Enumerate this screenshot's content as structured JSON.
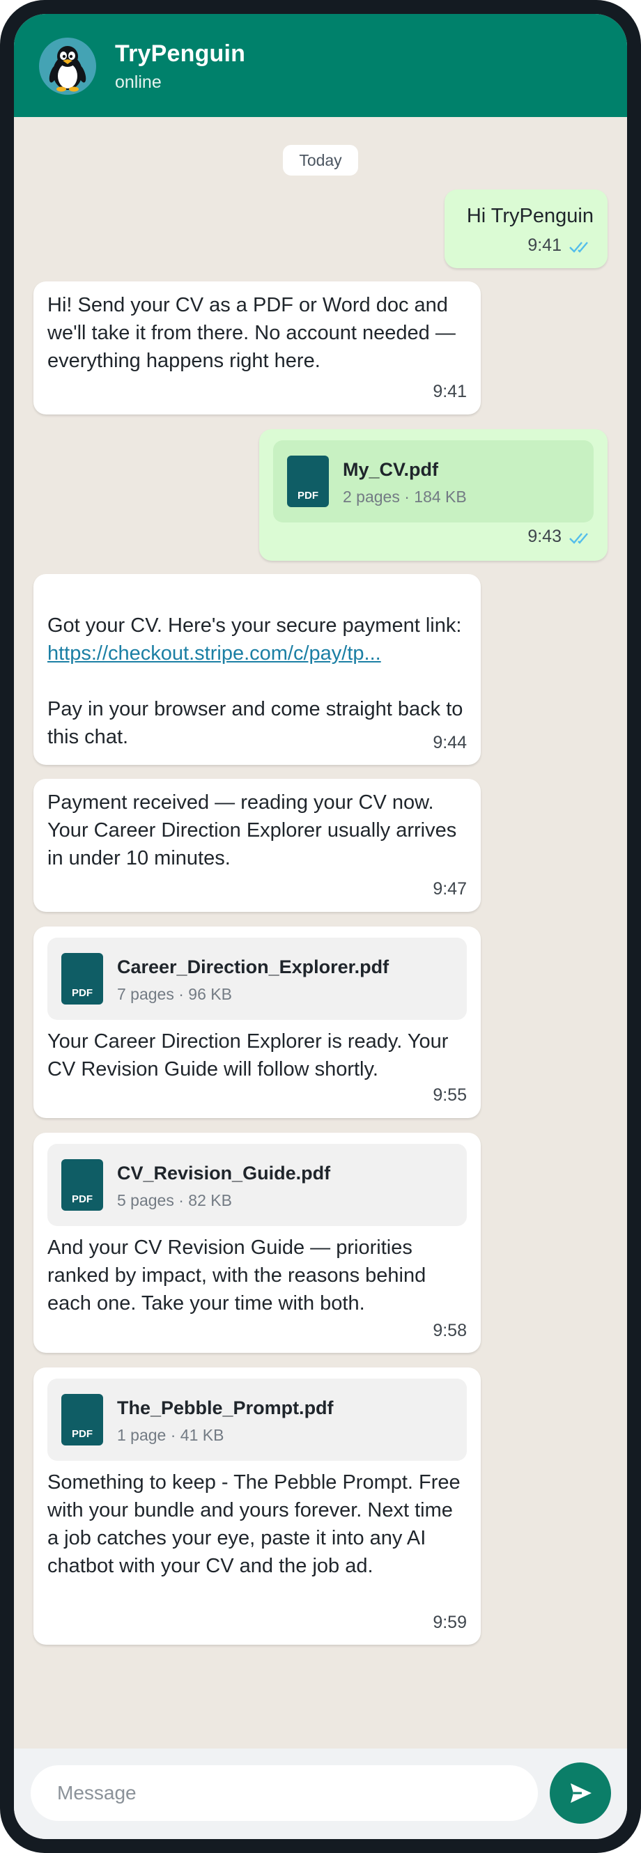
{
  "header": {
    "title": "TryPenguin",
    "status": "online"
  },
  "date_chip": "Today",
  "messages": [
    {
      "dir": "out",
      "text": "Hi TryPenguin",
      "time": "9:41",
      "ticks": "read"
    },
    {
      "dir": "in",
      "text": "Hi! Send your CV as a PDF or Word doc and we'll take it from there. No account needed — everything happens right here.",
      "time": "9:41"
    },
    {
      "dir": "out",
      "file": {
        "name": "My_CV.pdf",
        "meta": "2 pages · 184 KB",
        "icon_label": "PDF"
      },
      "time": "9:43",
      "ticks": "read"
    },
    {
      "dir": "in",
      "text_before": "Got your CV. Here's your secure payment link:",
      "link": "https://checkout.stripe.com/c/pay/tp...",
      "text_after": "Pay in your browser and come straight back to this chat.",
      "time": "9:44"
    },
    {
      "dir": "in",
      "text": "Payment received — reading your CV now. Your Career Direction Explorer usually arrives in under 10 minutes.",
      "time": "9:47"
    },
    {
      "dir": "in",
      "file": {
        "name": "Career_Direction_Explorer.pdf",
        "meta": "7 pages · 96 KB",
        "icon_label": "PDF"
      },
      "text": "Your Career Direction Explorer is ready. Your CV Revision Guide will follow shortly.",
      "time": "9:55"
    },
    {
      "dir": "in",
      "file": {
        "name": "CV_Revision_Guide.pdf",
        "meta": "5 pages · 82 KB",
        "icon_label": "PDF"
      },
      "text": "And your CV Revision Guide — priorities ranked by impact, with the reasons behind each one. Take your time with both.",
      "time": "9:58"
    },
    {
      "dir": "in",
      "file": {
        "name": "The_Pebble_Prompt.pdf",
        "meta": "1 page · 41 KB",
        "icon_label": "PDF"
      },
      "text": "Something to keep - The Pebble Prompt. Free with your bundle and yours forever. Next time a job catches your eye, paste it into any AI chatbot with your CV and the job ad.",
      "time": "9:59"
    }
  ],
  "composer": {
    "placeholder": "Message"
  },
  "icons": {
    "avatar": "penguin-icon",
    "file": "pdf-file-icon",
    "read_receipt": "double-check-icon",
    "send": "send-icon"
  },
  "colors": {
    "header": "#00816b",
    "outgoing_bubble": "#dbfbd4",
    "incoming_bubble": "#ffffff",
    "chat_background": "#ede8e1",
    "link": "#1b7fa4",
    "read_ticks": "#53bdeb",
    "send_button": "#0b7e68"
  }
}
